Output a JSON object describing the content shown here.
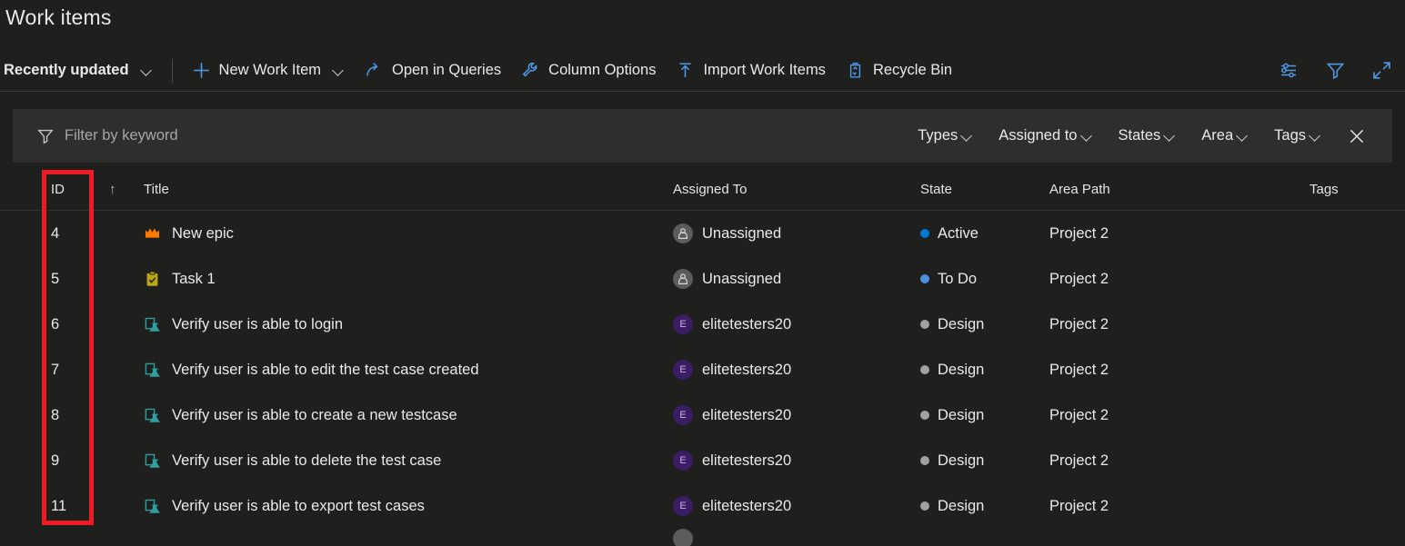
{
  "page": {
    "title": "Work items"
  },
  "toolbar": {
    "view_selector": {
      "label": "Recently updated",
      "icon": "chevron-down-icon"
    },
    "items": [
      {
        "label": "New Work Item",
        "icon": "plus-icon",
        "has_chevron": true
      },
      {
        "label": "Open in Queries",
        "icon": "open-in-queries-icon",
        "has_chevron": false
      },
      {
        "label": "Column Options",
        "icon": "wrench-icon",
        "has_chevron": false
      },
      {
        "label": "Import Work Items",
        "icon": "upload-icon",
        "has_chevron": false
      },
      {
        "label": "Recycle Bin",
        "icon": "recycle-bin-icon",
        "has_chevron": false
      }
    ],
    "right_icons": [
      {
        "name": "settings-sliders-icon"
      },
      {
        "name": "filter-funnel-icon"
      },
      {
        "name": "expand-fullscreen-icon"
      }
    ]
  },
  "filter_bar": {
    "keyword_placeholder": "Filter by keyword",
    "keyword_icon": "filter-funnel-icon",
    "pills": [
      "Types",
      "Assigned to",
      "States",
      "Area",
      "Tags"
    ],
    "close_icon": "close-icon"
  },
  "grid": {
    "columns": [
      "ID",
      "Title",
      "Assigned To",
      "State",
      "Area Path",
      "Tags"
    ],
    "sort_indicator": "↑",
    "rows": [
      {
        "id": "4",
        "type_icon": "epic-crown-icon",
        "title": "New epic",
        "assigned_to": "Unassigned",
        "avatar": "unassigned",
        "avatar_initial": "",
        "state": "Active",
        "state_color": "#0078d4",
        "area_path": "Project 2",
        "tags": ""
      },
      {
        "id": "5",
        "type_icon": "task-clipboard-icon",
        "title": "Task 1",
        "assigned_to": "Unassigned",
        "avatar": "unassigned",
        "avatar_initial": "",
        "state": "To Do",
        "state_color": "#4a90e2",
        "area_path": "Project 2",
        "tags": ""
      },
      {
        "id": "6",
        "type_icon": "test-case-icon",
        "title": "Verify user is able to login",
        "assigned_to": "elitetesters20",
        "avatar": "initial",
        "avatar_initial": "E",
        "state": "Design",
        "state_color": "#a0a0a0",
        "area_path": "Project 2",
        "tags": ""
      },
      {
        "id": "7",
        "type_icon": "test-case-icon",
        "title": "Verify user is able to edit the test case created",
        "assigned_to": "elitetesters20",
        "avatar": "initial",
        "avatar_initial": "E",
        "state": "Design",
        "state_color": "#a0a0a0",
        "area_path": "Project 2",
        "tags": ""
      },
      {
        "id": "8",
        "type_icon": "test-case-icon",
        "title": "Verify user is able to create a new testcase",
        "assigned_to": "elitetesters20",
        "avatar": "initial",
        "avatar_initial": "E",
        "state": "Design",
        "state_color": "#a0a0a0",
        "area_path": "Project 2",
        "tags": ""
      },
      {
        "id": "9",
        "type_icon": "test-case-icon",
        "title": "Verify user is able to delete the test case",
        "assigned_to": "elitetesters20",
        "avatar": "initial",
        "avatar_initial": "E",
        "state": "Design",
        "state_color": "#a0a0a0",
        "area_path": "Project 2",
        "tags": ""
      },
      {
        "id": "11",
        "type_icon": "test-case-icon",
        "title": "Verify user is able to export test cases",
        "assigned_to": "elitetesters20",
        "avatar": "initial",
        "avatar_initial": "E",
        "state": "Design",
        "state_color": "#a0a0a0",
        "area_path": "Project 2",
        "tags": ""
      }
    ]
  },
  "annotation": {
    "target_column": "ID",
    "color": "#ee1b24"
  },
  "colors": {
    "background": "#1f1f1e",
    "filter_bar_background": "#2e2e2d",
    "accent_blue": "#58a6ff",
    "text_primary": "#eaeae8",
    "epic_icon": "#ff7b00",
    "task_icon": "#b8a618",
    "test_case_icon": "#2e9e9e"
  }
}
